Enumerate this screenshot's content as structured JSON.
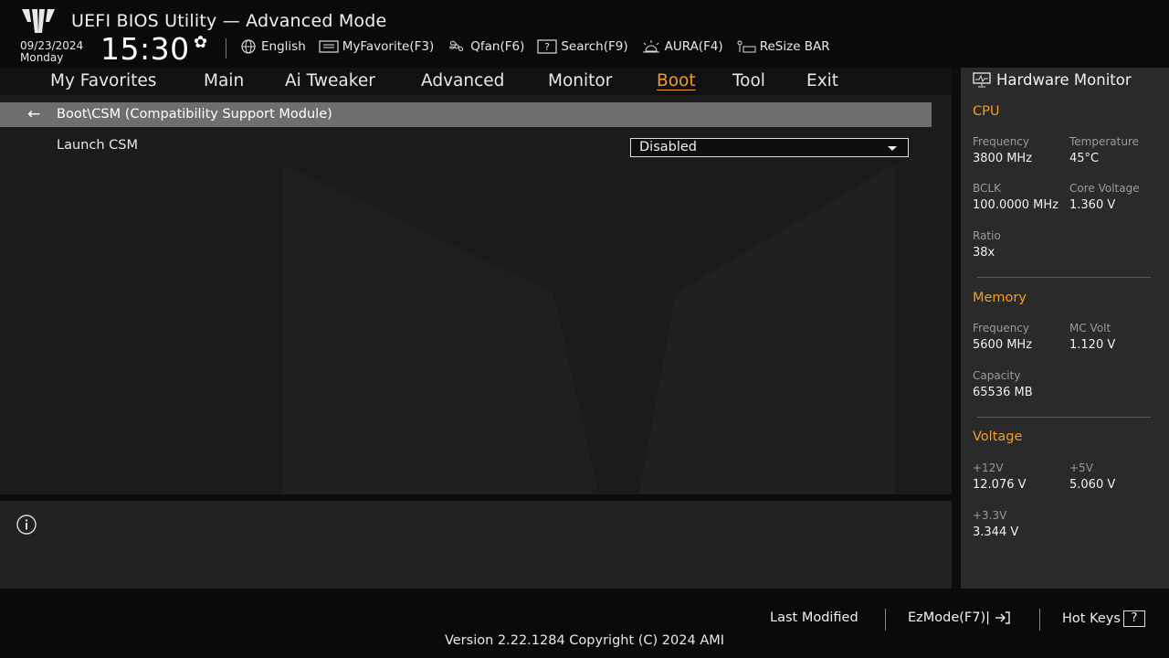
{
  "header": {
    "title": "UEFI BIOS Utility — Advanced Mode",
    "date": "09/23/2024",
    "weekday": "Monday",
    "time": "15:30"
  },
  "toolbar": {
    "language": "English",
    "favorite": "MyFavorite(F3)",
    "qfan": "Qfan(F6)",
    "search": "Search(F9)",
    "aura": "AURA(F4)",
    "resize": "ReSize BAR"
  },
  "nav": {
    "tabs": [
      "My Favorites",
      "Main",
      "Ai Tweaker",
      "Advanced",
      "Monitor",
      "Boot",
      "Tool",
      "Exit"
    ],
    "active": "Boot"
  },
  "breadcrumb": "Boot\\CSM (Compatibility Support Module)",
  "settings": [
    {
      "label": "Launch CSM",
      "value": "Disabled"
    }
  ],
  "hw_monitor": {
    "title": "Hardware Monitor",
    "cpu": {
      "heading": "CPU",
      "frequency_label": "Frequency",
      "frequency": "3800 MHz",
      "temperature_label": "Temperature",
      "temperature": "45°C",
      "bclk_label": "BCLK",
      "bclk": "100.0000 MHz",
      "core_voltage_label": "Core Voltage",
      "core_voltage": "1.360 V",
      "ratio_label": "Ratio",
      "ratio": "38x"
    },
    "memory": {
      "heading": "Memory",
      "frequency_label": "Frequency",
      "frequency": "5600 MHz",
      "mc_volt_label": "MC Volt",
      "mc_volt": "1.120 V",
      "capacity_label": "Capacity",
      "capacity": "65536 MB"
    },
    "voltage": {
      "heading": "Voltage",
      "v12_label": "+12V",
      "v12": "12.076 V",
      "v5_label": "+5V",
      "v5": "5.060 V",
      "v33_label": "+3.3V",
      "v33": "3.344 V"
    }
  },
  "footer": {
    "last_modified": "Last Modified",
    "ezmode": "EzMode(F7)|",
    "hotkeys": "Hot Keys",
    "hotkeys_key": "?",
    "version": "Version 2.22.1284 Copyright (C) 2024 AMI"
  },
  "colors": {
    "accent": "#f39c2a",
    "crumb_bar": "#6e6e6e",
    "panel": "#2a2a2a"
  },
  "icons": [
    "tuf-logo",
    "gear-icon",
    "globe-icon",
    "favorite-icon",
    "fan-icon",
    "search-icon",
    "aura-icon",
    "resize-bar-icon",
    "back-arrow-icon",
    "info-icon",
    "monitor-icon",
    "exit-arrow-icon"
  ]
}
